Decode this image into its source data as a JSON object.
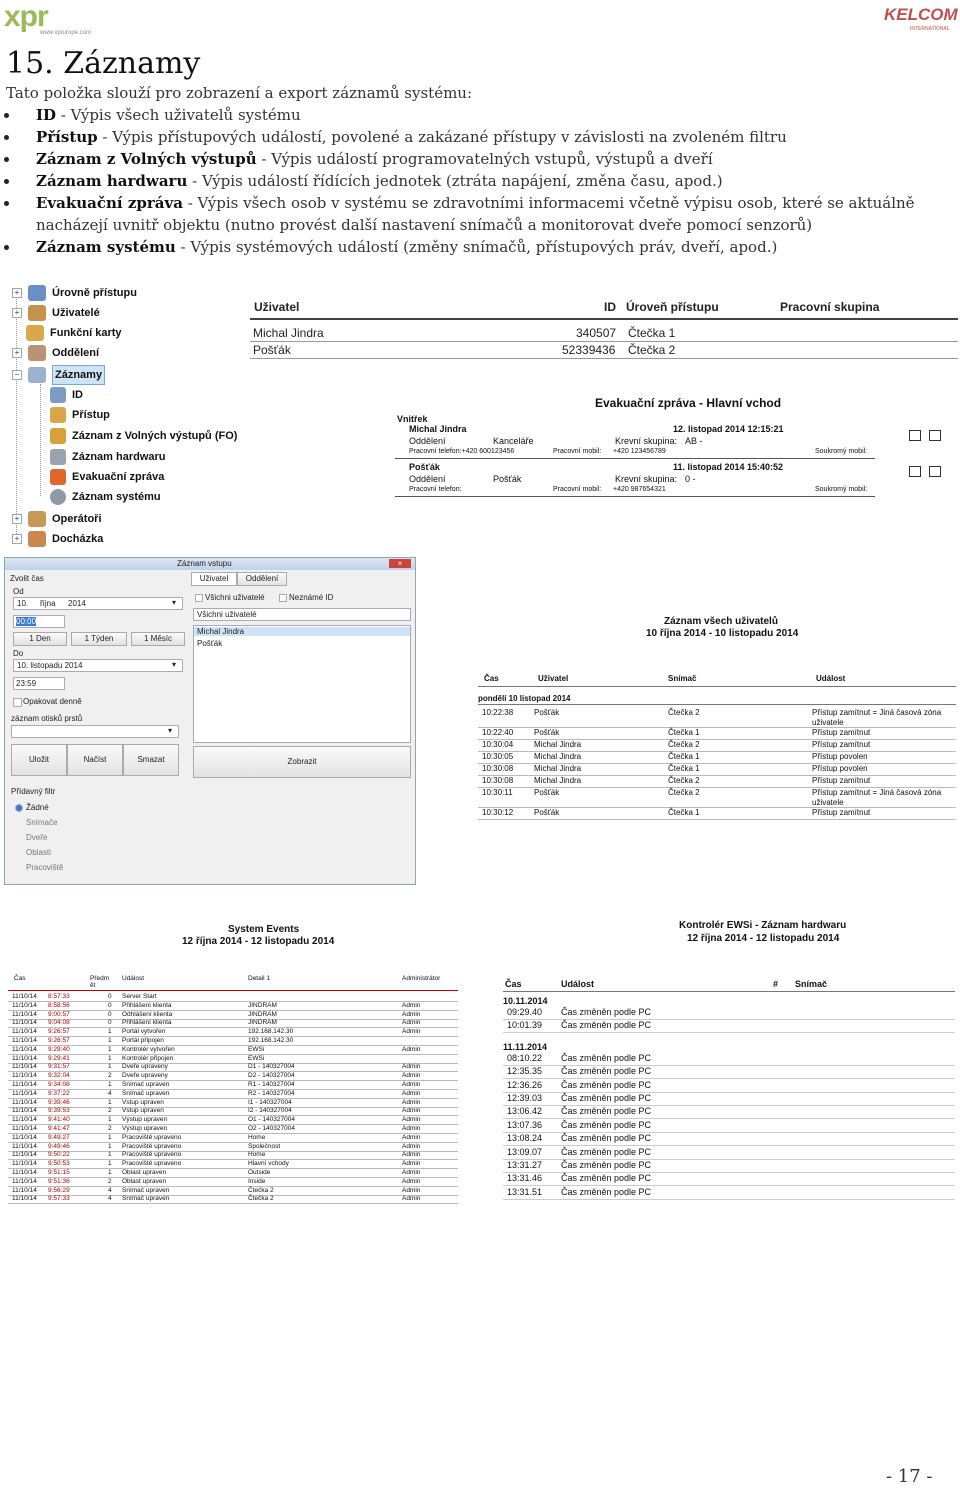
{
  "header": {
    "logo_left": "xpr",
    "logo_left_url": "www.xprurope.com",
    "logo_right": "KELCOM",
    "logo_right_sub": "INTERNATIONAL"
  },
  "title": "15. Záznamy",
  "intro": "Tato položka slouží pro zobrazení a export záznamů systému:",
  "bullets": [
    {
      "bold": "ID",
      "text": " - Výpis všech uživatelů systému"
    },
    {
      "bold": "Přístup",
      "text": " - Výpis přístupových událostí, povolené a zakázané přístupy v závislosti na zvoleném filtru"
    },
    {
      "bold": "Záznam z Volných výstupů",
      "text": " - Výpis událostí programovatelných vstupů, výstupů a dveří"
    },
    {
      "bold": "Záznam hardwaru",
      "text": " - Výpis událostí řídících jednotek (ztráta napájení, změna času, apod.)"
    },
    {
      "bold": "Evakuační zpráva",
      "text": " - Výpis všech osob v systému se zdravotními informacemi včetně výpisu osob, které se aktuálně nacházejí uvnitř objektu (nutno provést další nastavení snímačů a monitorovat dveře pomocí senzorů)"
    },
    {
      "bold": "Záznam systému",
      "text": " - Výpis systémových událostí (změny snímačů, přístupových práv, dveří, apod.)"
    }
  ],
  "tree": {
    "items": [
      "Úrovně přístupu",
      "Uživatelé",
      "Funkční karty",
      "Oddělení",
      "Záznamy",
      "ID",
      "Přístup",
      "Záznam z Volných výstupů (FO)",
      "Záznam hardwaru",
      "Evakuační zpráva",
      "Záznam systému",
      "Operátoři",
      "Docházka"
    ]
  },
  "user_table": {
    "headers": [
      "Uživatel",
      "ID",
      "Úroveň přístupu",
      "Pracovní skupina"
    ],
    "rows": [
      [
        "Michal Jindra",
        "340507",
        "Čtečka 1"
      ],
      [
        "Pošťák",
        "52339436",
        "Čtečka 2"
      ]
    ]
  },
  "evac": {
    "title": "Evakuační zpráva - Hlavní vchod",
    "inside": "Vnitřek",
    "p1": {
      "name": "Michal Jindra",
      "date": "12. listopad 2014  12:15:21",
      "dept_l": "Oddělení",
      "dept": "Kanceláře",
      "blood_l": "Krevní skupina:",
      "blood": "AB -",
      "emerg": "Pracovní telefon:+420 600123456",
      "mobile": "Pracovní mobil:",
      "mobile_v": "+420 123456789",
      "priv": "Soukromý mobil:"
    },
    "p2": {
      "name": "Pošťák",
      "date": "11. listopad 2014  15:40:52",
      "dept_l": "Oddělení",
      "dept": "Pošťák",
      "blood_l": "Krevní skupina:",
      "blood": "0 -",
      "emerg": "Pracovní telefon:",
      "mobile": "Pracovní mobil:",
      "mobile_v": "+420 987654321",
      "priv": "Soukromý mobil:"
    }
  },
  "dialog": {
    "title": "Záznam vstupu",
    "close": "×",
    "time_group": "Zvolit čas",
    "od": "Od",
    "od_day": "10.",
    "od_month": "října",
    "od_year": "2014",
    "od_time": "00:00",
    "btn_day": "1 Den",
    "btn_week": "1 Týden",
    "btn_month": "1 Měsíc",
    "do": "Do",
    "do_date": "10. listopadu 2014",
    "do_time": "23:59",
    "repeat": "Opakovat denně",
    "tpl_label": "záznam otisků prstů",
    "save": "Uložit",
    "load": "Načíst",
    "delete": "Smazat",
    "filter_title": "Přídavný filtr",
    "filters": [
      "Žádné",
      "Snímače",
      "Dveře",
      "Oblasti",
      "Pracoviště"
    ],
    "tab_user": "Uživatel",
    "tab_dept": "Oddělení",
    "all_users": "Všichni uživatelé",
    "unknown": "Neznámé ID",
    "combo": "Všichni uživatelé",
    "list": [
      "Michal Jindra",
      "Pošťák"
    ],
    "show": "Zobrazit"
  },
  "all_users": {
    "title": "Záznam všech uživatelů",
    "range": "10 října 2014 - 10 listopadu 2014",
    "headers": [
      "Čas",
      "Uživatel",
      "Snímač",
      "Událost"
    ],
    "day": "pondělí  10  listopad  2014",
    "rows": [
      [
        "10:22:38",
        "Pošťák",
        "Čtečka 2",
        "Přístup zamítnut = Jiná časová zóna uživatele"
      ],
      [
        "10:22:40",
        "Pošťák",
        "Čtečka 1",
        "Přístup zamítnut"
      ],
      [
        "10:30:04",
        "Michal Jindra",
        "Čtečka 2",
        "Přístup zamítnut"
      ],
      [
        "10:30:05",
        "Michal Jindra",
        "Čtečka 1",
        "Přístup povolen"
      ],
      [
        "10:30:08",
        "Michal Jindra",
        "Čtečka 1",
        "Přístup povolen"
      ],
      [
        "10:30:08",
        "Michal Jindra",
        "Čtečka 2",
        "Přístup zamítnut"
      ],
      [
        "10:30:11",
        "Pošťák",
        "Čtečka 2",
        "Přístup zamítnut = Jiná časová zóna uživatele"
      ],
      [
        "10:30:12",
        "Pošťák",
        "Čtečka 1",
        "Přístup zamítnut"
      ]
    ]
  },
  "system_events": {
    "title": "System Events",
    "range": "12 října 2014 - 12 listopadu 2014",
    "headers": [
      "Čas",
      "Předm ět",
      "Událost",
      "Detail 1",
      "Administrátor"
    ],
    "rows": [
      [
        "11/10/14",
        "8:57:33",
        "0",
        "Server Start",
        "",
        ""
      ],
      [
        "11/10/14",
        "8:58:56",
        "0",
        "Přihlášení klienta",
        "JINDRAM",
        "Admin"
      ],
      [
        "11/10/14",
        "9:00:57",
        "0",
        "Odhlášení klienta",
        "JINDRAM",
        "Admin"
      ],
      [
        "11/10/14",
        "9:04:08",
        "0",
        "Přihlášení klienta",
        "JINDRAM",
        "Admin"
      ],
      [
        "11/10/14",
        "9:26:57",
        "1",
        "Portál vytvořen",
        "192.168.142.30",
        "Admin"
      ],
      [
        "11/10/14",
        "9:26:57",
        "1",
        "Portál připojen",
        "192.168.142.30",
        ""
      ],
      [
        "11/10/14",
        "9:29:40",
        "1",
        "Kontrolér vytvořen",
        "EWSi",
        "Admin"
      ],
      [
        "11/10/14",
        "9:29:41",
        "1",
        "Kontrolér připojen",
        "EWSi",
        ""
      ],
      [
        "11/10/14",
        "9:31:57",
        "1",
        "Dveře upraveny",
        "D1 - 140327004",
        "Admin"
      ],
      [
        "11/10/14",
        "9:32:04",
        "2",
        "Dveře upraveny",
        "D2 - 140327004",
        "Admin"
      ],
      [
        "11/10/14",
        "9:34:08",
        "1",
        "Snímač upraven",
        "R1 - 140327004",
        "Admin"
      ],
      [
        "11/10/14",
        "9:37:22",
        "4",
        "Snímač upraven",
        "R2 - 140327004",
        "Admin"
      ],
      [
        "11/10/14",
        "9:39:46",
        "1",
        "Vstup upraven",
        "I1 - 140327004",
        "Admin"
      ],
      [
        "11/10/14",
        "9:39:53",
        "2",
        "Vstup upraven",
        "I2 - 140327004",
        "Admin"
      ],
      [
        "11/10/14",
        "9:41:40",
        "1",
        "Výstup upraven",
        "O1 - 140327004",
        "Admin"
      ],
      [
        "11/10/14",
        "9:41:47",
        "2",
        "Výstup upraven",
        "O2 - 140327004",
        "Admin"
      ],
      [
        "11/10/14",
        "9:49:27",
        "1",
        "Pracoviště upraveno",
        "Home",
        "Admin"
      ],
      [
        "11/10/14",
        "9:49:46",
        "1",
        "Pracoviště upraveno",
        "Společnost",
        "Admin"
      ],
      [
        "11/10/14",
        "9:50:22",
        "1",
        "Pracoviště upraveno",
        "Home",
        "Admin"
      ],
      [
        "11/10/14",
        "9:50:53",
        "1",
        "Pracoviště upraveno",
        "Hlavní vchody",
        "Admin"
      ],
      [
        "11/10/14",
        "9:51:15",
        "1",
        "Oblast upraven",
        "Outside",
        "Admin"
      ],
      [
        "11/10/14",
        "9:51:36",
        "2",
        "Oblast upraven",
        "Inside",
        "Admin"
      ],
      [
        "11/10/14",
        "9:56:29",
        "4",
        "Snímač upraven",
        "Čtečka 2",
        "Admin"
      ],
      [
        "11/10/14",
        "9:57:33",
        "4",
        "Snímač upraven",
        "Čtečka 2",
        "Admin"
      ]
    ]
  },
  "hardware": {
    "title": "Kontrolér EWSi - Záznam hardwaru",
    "range": "12 října 2014 - 12 listopadu 2014",
    "headers": [
      "Čas",
      "Událost",
      "#",
      "Snímač"
    ],
    "days": [
      {
        "date": "10.11.2014",
        "rows": [
          [
            "09:29.40",
            "Čas změněn podle PC"
          ],
          [
            "10:01.39",
            "Čas změněn podle PC"
          ]
        ]
      },
      {
        "date": "11.11.2014",
        "rows": [
          [
            "08:10.22",
            "Čas změněn podle PC"
          ],
          [
            "12:35.35",
            "Čas změněn podle PC"
          ],
          [
            "12:36.26",
            "Čas změněn podle PC"
          ],
          [
            "12:39.03",
            "Čas změněn podle PC"
          ],
          [
            "13:06.42",
            "Čas změněn podle PC"
          ],
          [
            "13:07.36",
            "Čas změněn podle PC"
          ],
          [
            "13:08.24",
            "Čas změněn podle PC"
          ],
          [
            "13:09.07",
            "Čas změněn podle PC"
          ],
          [
            "13:31.27",
            "Čas změněn podle PC"
          ],
          [
            "13:31.46",
            "Čas změněn podle PC"
          ],
          [
            "13:31.51",
            "Čas změněn podle PC"
          ]
        ]
      }
    ]
  },
  "page_number": "- 17 -",
  "colors": {
    "accent_green": "#9bbb59",
    "kelcom_red": "#c0504d",
    "selection": "#cfe3f7"
  }
}
